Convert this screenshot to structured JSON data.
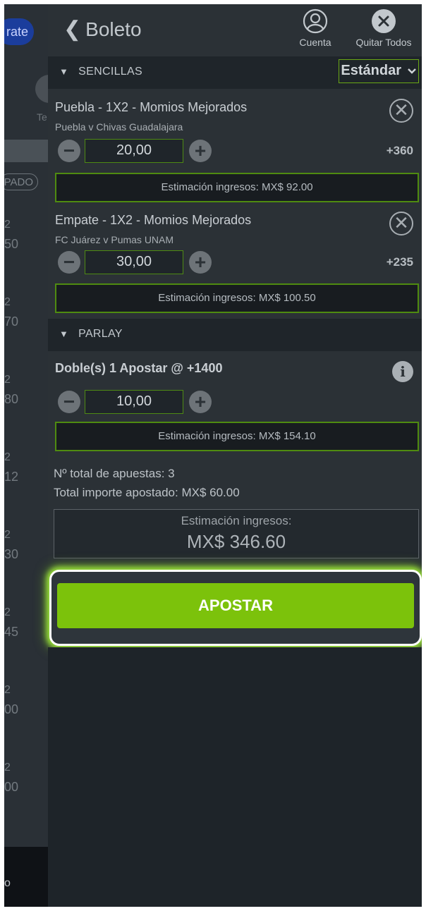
{
  "background": {
    "pill_label": "rate",
    "side_label_a": "Te",
    "side_label_b": "",
    "tag_label": "PADO",
    "odds_rows": [
      {
        "top": "2",
        "bottom": "50"
      },
      {
        "top": "2",
        "bottom": "70"
      },
      {
        "top": "2",
        "bottom": "80"
      },
      {
        "top": "2",
        "bottom": "12"
      },
      {
        "top": "2",
        "bottom": "30"
      },
      {
        "top": "2",
        "bottom": "45"
      },
      {
        "top": "2",
        "bottom": "00"
      },
      {
        "top": "2",
        "bottom": "00"
      }
    ],
    "bottom_label": "o"
  },
  "header": {
    "back_chevron": "❮",
    "title": "Boleto",
    "account_label": "Cuenta",
    "clear_all_label": "Quitar Todos"
  },
  "singles": {
    "section_label": "SENCILLAS",
    "mode_select": "Estándar"
  },
  "bets": [
    {
      "title": "Puebla - 1X2 - Momios Mejorados",
      "subtitle": "Puebla v Chivas Guadalajara",
      "stake": "20,00",
      "odds": "+360",
      "estimate": "Estimación ingresos: MX$ 92.00"
    },
    {
      "title": "Empate - 1X2 - Momios Mejorados",
      "subtitle": "FC Juárez v Pumas UNAM",
      "stake": "30,00",
      "odds": "+235",
      "estimate": "Estimación ingresos: MX$ 100.50"
    }
  ],
  "parlay": {
    "section_label": "PARLAY",
    "title": "Doble(s)   1 Apostar @ +1400",
    "stake": "10,00",
    "estimate": "Estimación ingresos: MX$ 154.10"
  },
  "summary": {
    "total_bets": "Nº total de apuestas: 3",
    "total_staked": "Total importe apostado: MX$ 60.00",
    "estimate_label": "Estimación ingresos:",
    "estimate_value": "MX$ 346.60"
  },
  "submit_label": "APOSTAR",
  "colors": {
    "accent": "#7cc20b",
    "panel": "#2b3136",
    "border_green": "#4f8b10"
  }
}
